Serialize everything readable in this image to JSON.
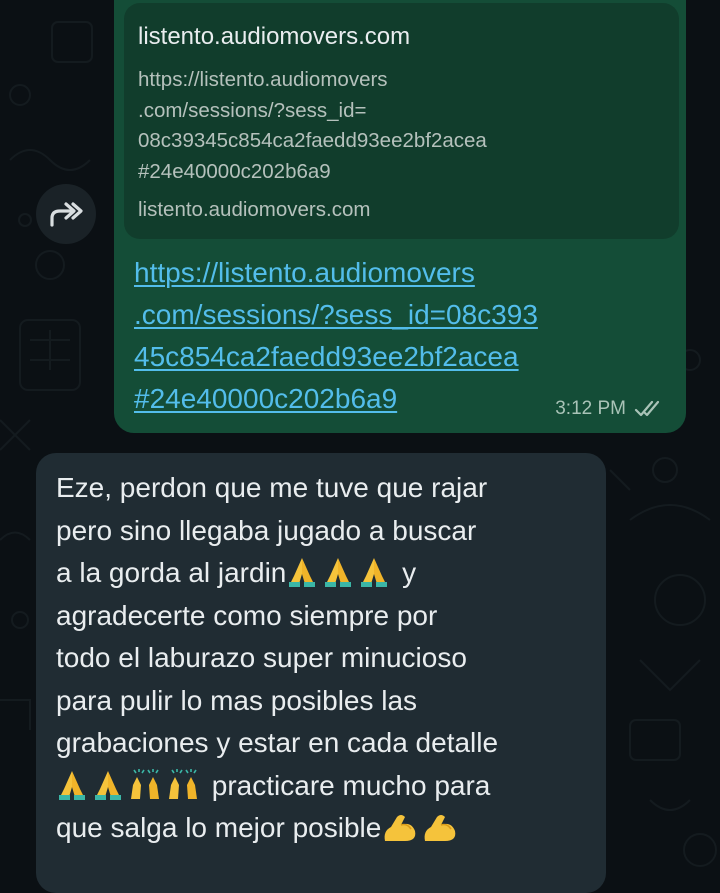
{
  "outgoing_message": {
    "preview": {
      "title": "listento.audiomovers.com",
      "description_lines": [
        "https://listento.audiomovers",
        ".com/sessions/?sess_id=",
        "08c39345c854ca2faedd93ee2bf2acea",
        "#24e40000c202b6a9"
      ],
      "domain": "listento.audiomovers.com"
    },
    "link_lines": [
      "https://listento.audiomovers",
      ".com/sessions/?sess_id=08c393",
      "45c854ca2faedd93ee2bf2acea",
      "#24e40000c202b6a9"
    ],
    "time": "3:12 PM",
    "status_icon": "double-check-icon"
  },
  "forward_button": {
    "icon": "forward-arrow-icon"
  },
  "incoming_message": {
    "line1": "Eze, perdon que me tuve que rajar",
    "line2": "pero sino llegaba jugado a buscar",
    "line3_text": "a la gorda al jardin",
    "line3_tail": " y",
    "line4": "agradecerte como siempre por",
    "line5": "todo el laburazo super minucioso",
    "line6": "para pulir lo mas posibles las",
    "line7": "grabaciones y estar en cada detalle",
    "line8_tail": " practicare mucho para",
    "line9_text": "que salga lo mejor posible",
    "emojis": {
      "pray": "folded-hands-icon",
      "raise": "raising-hands-icon",
      "muscle": "flexed-biceps-icon"
    }
  },
  "colors": {
    "background": "#0b1014",
    "outgoing_bubble": "#144d37",
    "preview_card": "#113d2c",
    "incoming_bubble": "#202c33",
    "link": "#53bdeb",
    "text": "#e9edef"
  }
}
